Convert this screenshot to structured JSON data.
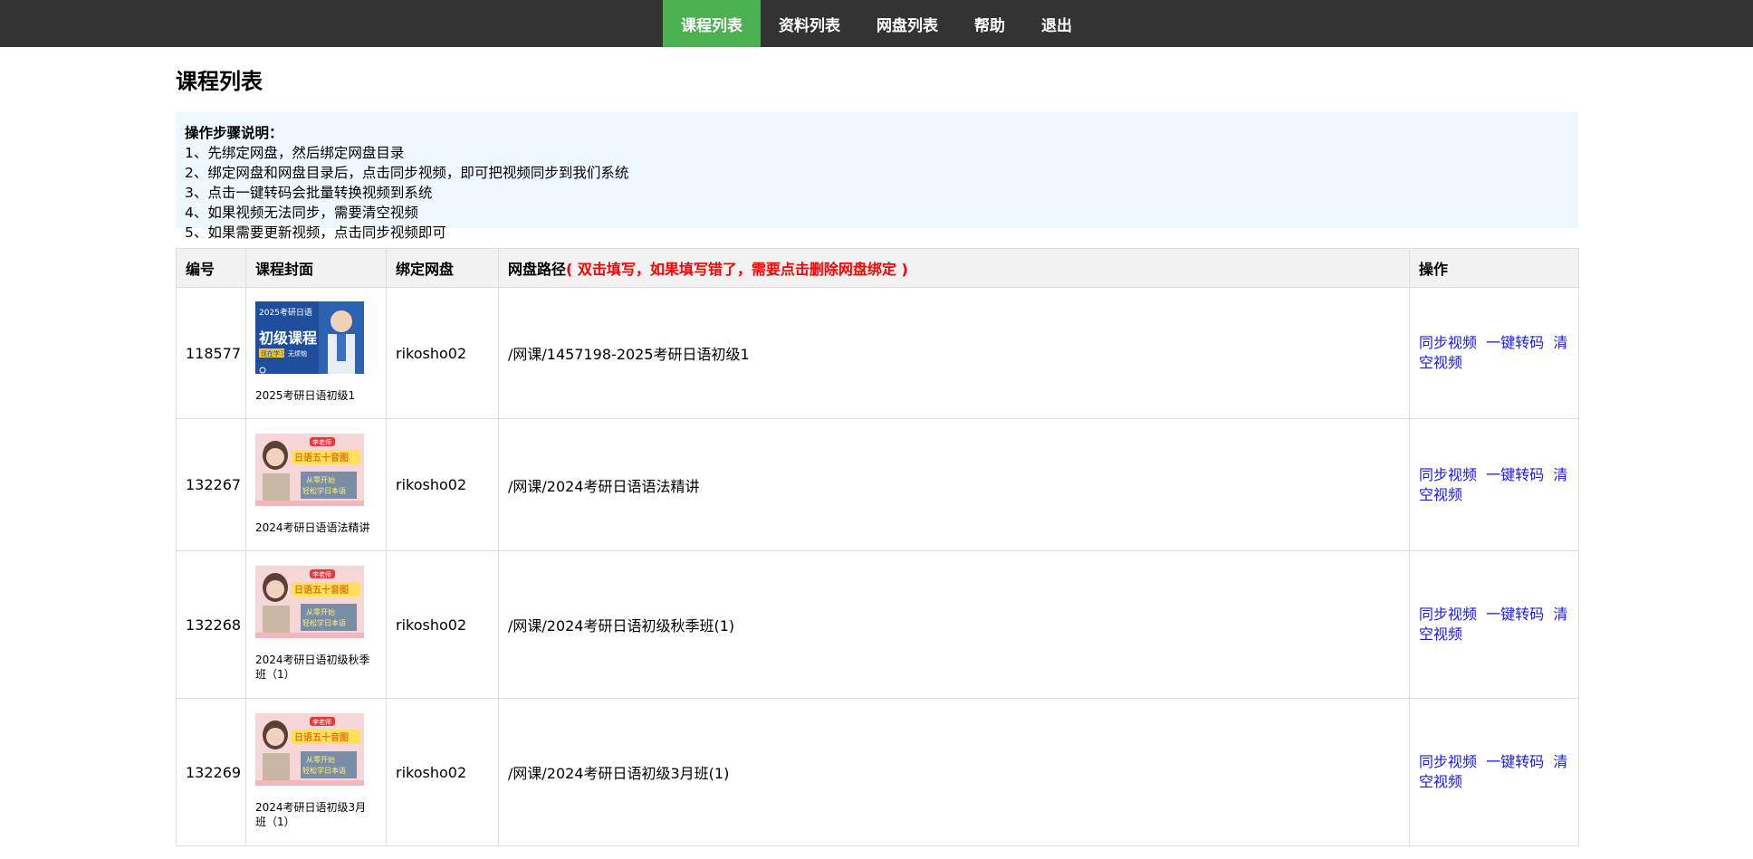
{
  "nav": {
    "items": [
      {
        "label": "课程列表",
        "active": true
      },
      {
        "label": "资料列表",
        "active": false
      },
      {
        "label": "网盘列表",
        "active": false
      },
      {
        "label": "帮助",
        "active": false
      },
      {
        "label": "退出",
        "active": false
      }
    ]
  },
  "page": {
    "title": "课程列表"
  },
  "instructions": {
    "title": "操作步骤说明：",
    "lines": [
      "1、先绑定网盘，然后绑定网盘目录",
      "2、绑定网盘和网盘目录后，点击同步视频，即可把视频同步到我们系统",
      "3、点击一键转码会批量转换视频到系统",
      "4、如果视频无法同步，需要清空视频",
      "5、如果需要更新视频，点击同步视频即可"
    ]
  },
  "table": {
    "headers": {
      "id": "编号",
      "cover": "课程封面",
      "disk": "绑定网盘",
      "path": "网盘路径",
      "path_note": "( 双击填写，如果填写错了，需要点击删除网盘绑定 )",
      "ops": "操作"
    },
    "ops_labels": {
      "sync": "同步视频",
      "transcode": "一键转码",
      "clear": "清空视频"
    },
    "rows": [
      {
        "id": "118577",
        "cover_caption": "2025考研日语初级1",
        "disk": "rikosho02",
        "path": "/网课/1457198-2025考研日语初级1"
      },
      {
        "id": "132267",
        "cover_caption": "2024考研日语语法精讲",
        "disk": "rikosho02",
        "path": "/网课/2024考研日语语法精讲"
      },
      {
        "id": "132268",
        "cover_caption": "2024考研日语初级秋季班（1）",
        "disk": "rikosho02",
        "path": "/网课/2024考研日语初级秋季班(1)"
      },
      {
        "id": "132269",
        "cover_caption": "2024考研日语初级3月班（1）",
        "disk": "rikosho02",
        "path": "/网课/2024考研日语初级3月班(1)"
      }
    ]
  },
  "cover_art": {
    "blue": {
      "top_text": "2025考研日语",
      "big_text": "初级课程",
      "tag1": "现在学习",
      "tag2": "无烦恼"
    },
    "pink": {
      "badge": "李老师",
      "banner": "日语五十音图",
      "tag1": "从零开始",
      "tag2": "轻松学日本语"
    }
  },
  "colors": {
    "nav_bg": "#333333",
    "nav_active": "#4caf50",
    "link": "#1a1ae6",
    "note_red": "#ff0000",
    "info_bg": "#eef6fe"
  }
}
